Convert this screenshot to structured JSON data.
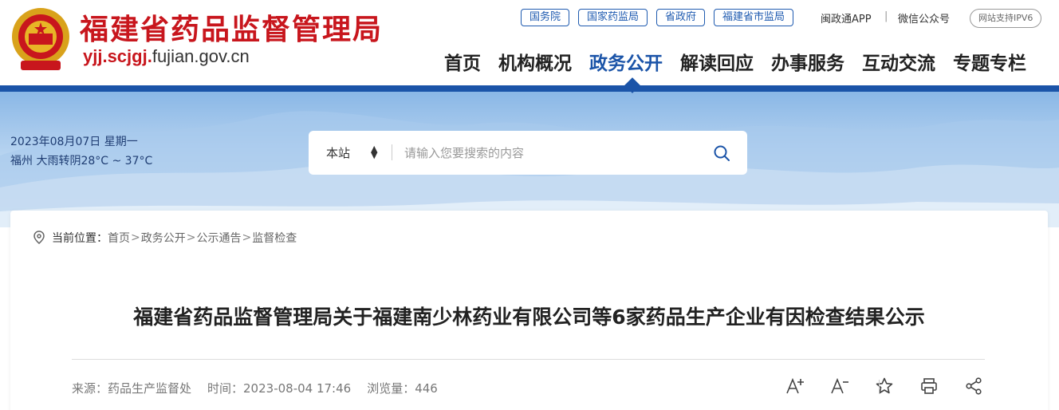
{
  "header": {
    "site_title": "福建省药品监督管理局",
    "domain_prefix": "yjj.scjgj.",
    "domain_suffix": "fujian.gov.cn",
    "top_links": [
      "国务院",
      "国家药监局",
      "省政府",
      "福建省市监局"
    ],
    "app_link": "闽政通APP",
    "wechat_link": "微信公众号",
    "ipv6_badge": "网站支持IPV6",
    "accent_color": "#1b54a8",
    "brand_red": "#c8161d"
  },
  "nav": {
    "items": [
      "首页",
      "机构概况",
      "政务公开",
      "解读回应",
      "办事服务",
      "互动交流",
      "专题专栏"
    ],
    "active": "政务公开"
  },
  "banner": {
    "date": "2023年08月07日 星期一",
    "weather": "福州 大雨转阴28°C ~ 37°C"
  },
  "search": {
    "scope": "本站",
    "scope_icon": "updown-arrow-icon",
    "placeholder": "请输入您要搜索的内容",
    "button_icon": "search-icon"
  },
  "breadcrumb": {
    "lead": "当前位置：",
    "items": [
      "首页",
      "政务公开",
      "公示通告",
      "监督检查"
    ]
  },
  "article": {
    "title": "福建省药品监督管理局关于福建南少林药业有限公司等6家药品生产企业有因检查结果公示",
    "source": "来源：药品生产监督处",
    "time": "时间：2023-08-04 17:46",
    "views": "浏览量：446"
  },
  "tools": {
    "items": [
      "font-increase-icon",
      "font-decrease-icon",
      "favorite-star-icon",
      "print-icon",
      "share-icon"
    ]
  }
}
